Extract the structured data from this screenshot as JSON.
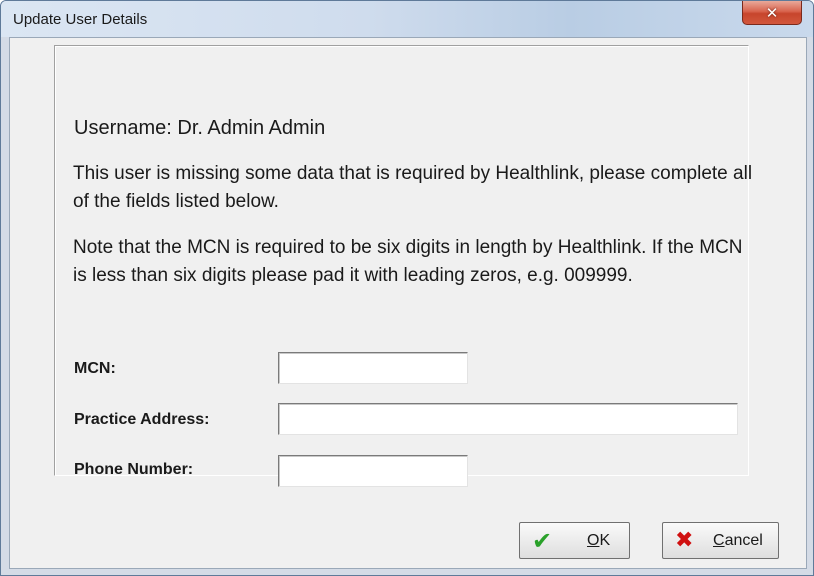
{
  "window": {
    "title": "Update User Details"
  },
  "icons": {
    "close": "close-icon",
    "ok": "check-icon",
    "cancel": "x-icon"
  },
  "colors": {
    "close_button": "#c7452c",
    "ok_check": "#2aa12a",
    "cancel_x": "#d01010"
  },
  "content": {
    "username": "Username: Dr. Admin Admin",
    "message1": "This user is missing some data that is required by Healthlink, please complete all of the fields listed below.",
    "message2": "Note that the MCN is required to be six digits in length by Healthlink.  If the MCN is less than six digits please pad it with leading zeros, e.g. 009999."
  },
  "fields": {
    "mcn": {
      "label": "MCN:",
      "value": ""
    },
    "practice_address": {
      "label": "Practice Address:",
      "value": ""
    },
    "phone_number": {
      "label": "Phone Number:",
      "value": ""
    }
  },
  "buttons": {
    "ok": {
      "mnemonic": "O",
      "rest": "K"
    },
    "cancel": {
      "mnemonic": "C",
      "rest": "ancel"
    }
  }
}
